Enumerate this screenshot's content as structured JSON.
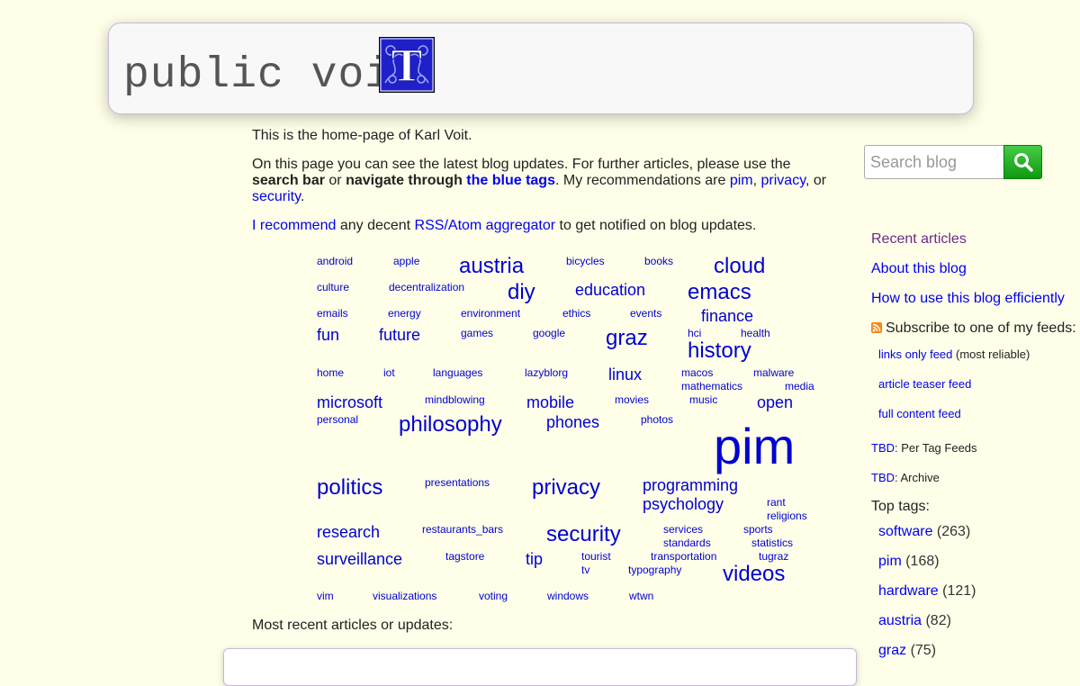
{
  "header": {
    "title": "public voi",
    "logo_letter": "T"
  },
  "intro": {
    "line1": "This is the home-page of Karl Voit.",
    "p2_a": "On this page you can see the latest blog updates. For further articles, please use the ",
    "p2_search": "search bar",
    "p2_or": " or ",
    "p2_navigate": "navigate through",
    "p2_space": " ",
    "p2_bluetags": "the blue tags",
    "p2_b": ". My recommendations are ",
    "rec1": "pim",
    "comma": ", ",
    "rec2": "privacy",
    "or_text": ", or",
    "rec3": "security",
    "period": ".",
    "p3_link1": "I recommend",
    "p3_mid": " any decent ",
    "p3_link2": "RSS/Atom aggregator",
    "p3_end": " to get notified on blog updates."
  },
  "tags": [
    {
      "t": "android",
      "s": 12
    },
    {
      "t": "apple",
      "s": 12
    },
    {
      "t": "austria",
      "s": 24
    },
    {
      "t": "bicycles",
      "s": 12
    },
    {
      "t": "books",
      "s": 12
    },
    {
      "t": "cloud",
      "s": 24
    },
    {
      "t": "culture",
      "s": 12
    },
    {
      "t": "decentralization",
      "s": 12
    },
    {
      "t": "diy",
      "s": 24
    },
    {
      "t": "education",
      "s": 18
    },
    {
      "t": "emacs",
      "s": 24
    },
    {
      "t": "emails",
      "s": 12
    },
    {
      "t": "energy",
      "s": 12
    },
    {
      "t": "environment",
      "s": 12
    },
    {
      "t": "ethics",
      "s": 12
    },
    {
      "t": "events",
      "s": 12
    },
    {
      "t": "finance",
      "s": 18
    },
    {
      "t": "fun",
      "s": 18
    },
    {
      "t": "future",
      "s": 18
    },
    {
      "t": "games",
      "s": 12
    },
    {
      "t": "google",
      "s": 12
    },
    {
      "t": "graz",
      "s": 24
    },
    {
      "t": "hci",
      "s": 12
    },
    {
      "t": "health",
      "s": 12
    },
    {
      "t": "history",
      "s": 24
    },
    {
      "t": "home",
      "s": 12
    },
    {
      "t": "iot",
      "s": 12
    },
    {
      "t": "languages",
      "s": 12
    },
    {
      "t": "lazyblorg",
      "s": 12
    },
    {
      "t": "linux",
      "s": 18
    },
    {
      "t": "macos",
      "s": 12
    },
    {
      "t": "malware",
      "s": 12
    },
    {
      "t": "mathematics",
      "s": 12
    },
    {
      "t": "media",
      "s": 12
    },
    {
      "t": "microsoft",
      "s": 18
    },
    {
      "t": "mindblowing",
      "s": 12
    },
    {
      "t": "mobile",
      "s": 18
    },
    {
      "t": "movies",
      "s": 12
    },
    {
      "t": "music",
      "s": 12
    },
    {
      "t": "open",
      "s": 18
    },
    {
      "t": "personal",
      "s": 12
    },
    {
      "t": "philosophy",
      "s": 24
    },
    {
      "t": "phones",
      "s": 18
    },
    {
      "t": "photos",
      "s": 12
    },
    {
      "t": "pim",
      "s": 56
    },
    {
      "t": "politics",
      "s": 24
    },
    {
      "t": "presentations",
      "s": 12
    },
    {
      "t": "privacy",
      "s": 24
    },
    {
      "t": "programming",
      "s": 18
    },
    {
      "t": "psychology",
      "s": 18
    },
    {
      "t": "rant",
      "s": 12
    },
    {
      "t": "religions",
      "s": 12
    },
    {
      "t": "research",
      "s": 18
    },
    {
      "t": "restaurants_bars",
      "s": 12
    },
    {
      "t": "security",
      "s": 24
    },
    {
      "t": "services",
      "s": 12
    },
    {
      "t": "sports",
      "s": 12
    },
    {
      "t": "standards",
      "s": 12
    },
    {
      "t": "statistics",
      "s": 12
    },
    {
      "t": "surveillance",
      "s": 18
    },
    {
      "t": "tagstore",
      "s": 12
    },
    {
      "t": "tip",
      "s": 18
    },
    {
      "t": "tourist",
      "s": 12
    },
    {
      "t": "transportation",
      "s": 12
    },
    {
      "t": "tugraz",
      "s": 12
    },
    {
      "t": "tv",
      "s": 12
    },
    {
      "t": "typography",
      "s": 12
    },
    {
      "t": "videos",
      "s": 24
    },
    {
      "t": "vim",
      "s": 12
    },
    {
      "t": "visualizations",
      "s": 12
    },
    {
      "t": "voting",
      "s": 12
    },
    {
      "t": "windows",
      "s": 12
    },
    {
      "t": "wtwn",
      "s": 12
    }
  ],
  "recent_label": "Most recent articles or updates:",
  "search": {
    "placeholder": "Search blog"
  },
  "sidebar": {
    "recent": "Recent articles",
    "about": "About this blog",
    "howto": "How to use this blog efficiently",
    "subscribe": "Subscribe to one of my feeds:",
    "feed1": "links only feed",
    "feed1_note": " (most reliable)",
    "feed2": "article teaser feed",
    "feed3": "full content feed",
    "tbd": "TBD",
    "tbd1_rest": ": Per Tag Feeds",
    "tbd2_rest": ": Archive",
    "top_tags": "Top tags:",
    "top": [
      {
        "name": "software",
        "count": "(263)"
      },
      {
        "name": "pim",
        "count": "(168)"
      },
      {
        "name": "hardware",
        "count": "(121)"
      },
      {
        "name": "austria",
        "count": "(82)"
      },
      {
        "name": "graz",
        "count": "(75)"
      }
    ]
  },
  "colors": {
    "background": "#ffffe9",
    "link": "#0000ee",
    "tag": "#0000d0",
    "search_button": "#22aa22",
    "recent_link": "#6a2a8a"
  }
}
